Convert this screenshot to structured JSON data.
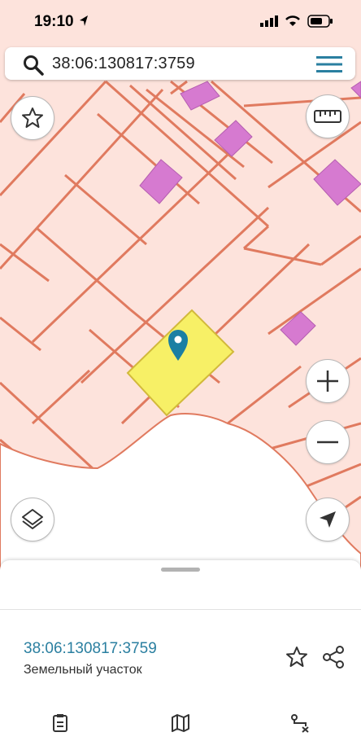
{
  "status_bar": {
    "time": "19:10"
  },
  "search": {
    "value": "38:06:130817:3759"
  },
  "parcel": {
    "cadastral_number": "38:06:130817:3759",
    "type": "Земельный участок"
  },
  "colors": {
    "map_background": "#fde3dc",
    "parcel_border": "#e07a5f",
    "building_fill": "#d67ad0",
    "selected_fill": "#f7f066",
    "accent": "#2a7fa0",
    "marker": "#1b7fa3"
  },
  "icons": [
    "search-icon",
    "menu-icon",
    "star-icon",
    "ruler-icon",
    "plus-icon",
    "minus-icon",
    "layers-icon",
    "navigation-icon",
    "share-icon",
    "clipboard-icon",
    "map-icon",
    "route-icon"
  ]
}
